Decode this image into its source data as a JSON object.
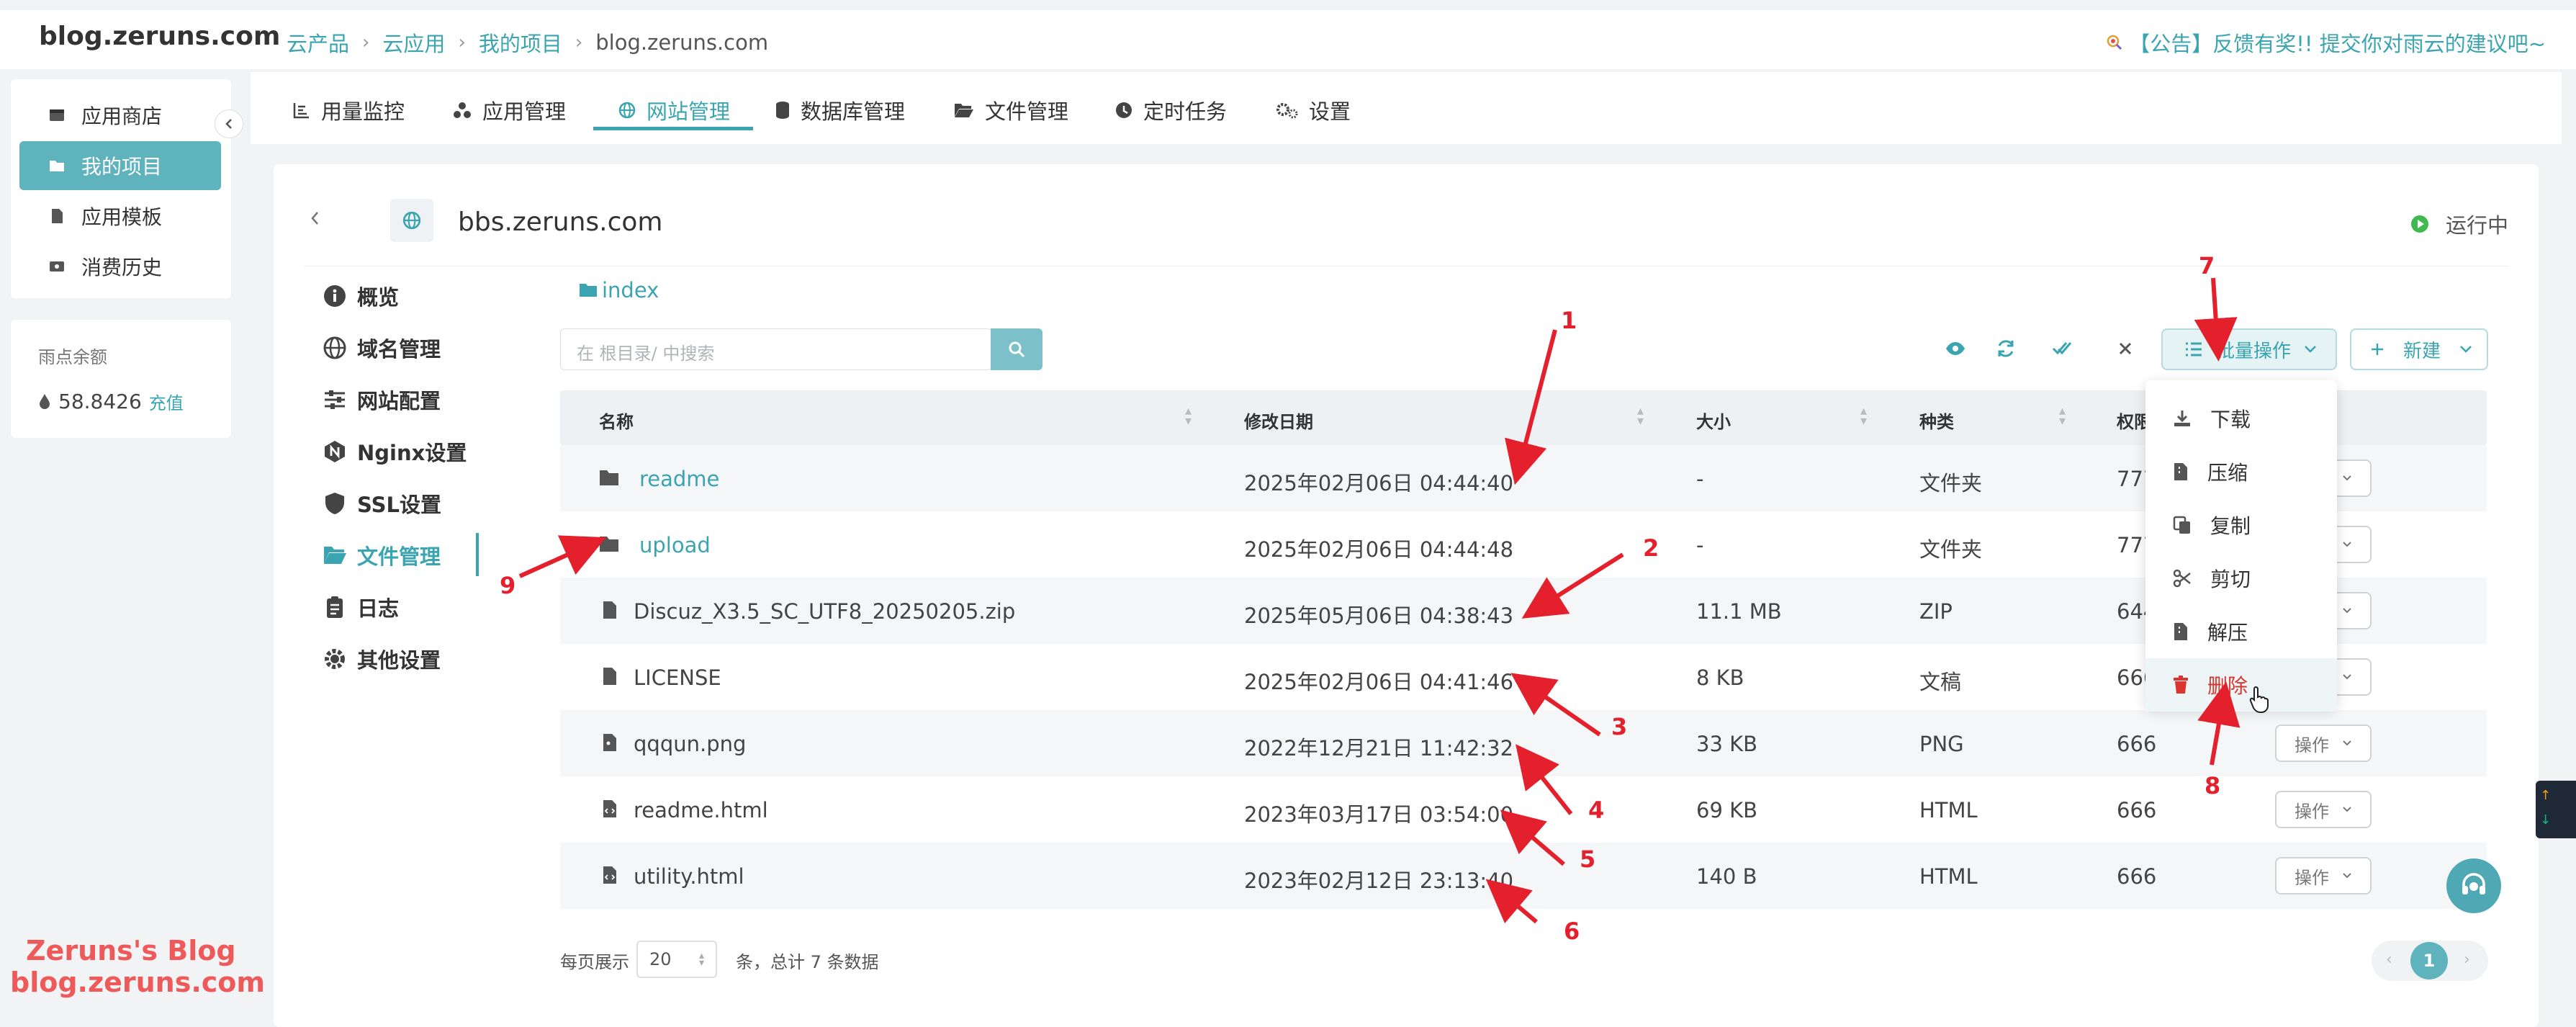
{
  "header": {
    "site": "blog.zeruns.com",
    "breadcrumb": [
      "云产品",
      "云应用",
      "我的项目",
      "blog.zeruns.com"
    ],
    "notice": "【公告】反馈有奖!! 提交你对雨云的建议吧~"
  },
  "sidebar": {
    "items": [
      {
        "label": "应用商店",
        "icon": "store-icon"
      },
      {
        "label": "我的项目",
        "icon": "folder-icon",
        "active": true
      },
      {
        "label": "应用模板",
        "icon": "template-icon"
      },
      {
        "label": "消费历史",
        "icon": "history-icon"
      }
    ]
  },
  "balance": {
    "label": "雨点余额",
    "amount": "58.8426",
    "recharge": "充值"
  },
  "tabs": [
    {
      "label": "用量监控",
      "icon": "chart-icon"
    },
    {
      "label": "应用管理",
      "icon": "apps-icon"
    },
    {
      "label": "网站管理",
      "icon": "globe-icon",
      "active": true
    },
    {
      "label": "数据库管理",
      "icon": "database-icon"
    },
    {
      "label": "文件管理",
      "icon": "folder-open-icon"
    },
    {
      "label": "定时任务",
      "icon": "clock-icon"
    },
    {
      "label": "设置",
      "icon": "gears-icon"
    }
  ],
  "site": {
    "title": "bbs.zeruns.com",
    "status": "运行中"
  },
  "site_menu": {
    "items": [
      {
        "label": "概览",
        "icon": "info-icon"
      },
      {
        "label": "域名管理",
        "icon": "globe-icon"
      },
      {
        "label": "网站配置",
        "icon": "sliders-icon"
      },
      {
        "label": "Nginx设置",
        "icon": "nginx-icon"
      },
      {
        "label": "SSL设置",
        "icon": "shield-icon"
      },
      {
        "label": "文件管理",
        "icon": "folder-open-icon",
        "active": true
      },
      {
        "label": "日志",
        "icon": "clipboard-icon"
      },
      {
        "label": "其他设置",
        "icon": "gear-icon"
      }
    ]
  },
  "files": {
    "path": "index",
    "search_placeholder": "在 根目录/ 中搜索",
    "batch_label": "批量操作",
    "new_label": "新建",
    "columns": [
      "名称",
      "修改日期",
      "大小",
      "种类",
      "权限"
    ],
    "rows": [
      {
        "name": "readme",
        "date": "2025年02月06日 04:44:40",
        "size": "-",
        "type": "文件夹",
        "perm": "777",
        "folder": true
      },
      {
        "name": "upload",
        "date": "2025年02月06日 04:44:48",
        "size": "-",
        "type": "文件夹",
        "perm": "777",
        "folder": true
      },
      {
        "name": "Discuz_X3.5_SC_UTF8_20250205.zip",
        "date": "2025年05月06日 04:38:43",
        "size": "11.1 MB",
        "type": "ZIP",
        "perm": "644"
      },
      {
        "name": "LICENSE",
        "date": "2025年02月06日 04:41:46",
        "size": "8 KB",
        "type": "文稿",
        "perm": "666"
      },
      {
        "name": "qqqun.png",
        "date": "2022年12月21日 11:42:32",
        "size": "33 KB",
        "type": "PNG",
        "perm": "666"
      },
      {
        "name": "readme.html",
        "date": "2023年03月17日 03:54:00",
        "size": "69 KB",
        "type": "HTML",
        "perm": "666"
      },
      {
        "name": "utility.html",
        "date": "2023年02月12日 23:13:40",
        "size": "140 B",
        "type": "HTML",
        "perm": "666"
      }
    ],
    "op_label": "操作"
  },
  "batch_menu": [
    {
      "label": "下载",
      "icon": "download-icon"
    },
    {
      "label": "压缩",
      "icon": "compress-icon"
    },
    {
      "label": "复制",
      "icon": "copy-icon"
    },
    {
      "label": "剪切",
      "icon": "scissors-icon"
    },
    {
      "label": "解压",
      "icon": "extract-icon"
    },
    {
      "label": "删除",
      "icon": "trash-icon",
      "danger": true
    }
  ],
  "pagination": {
    "per_page_label": "每页展示",
    "per_page": "20",
    "total_text": "条，总计 7 条数据",
    "page": "1"
  },
  "annotations": [
    "1",
    "2",
    "3",
    "4",
    "5",
    "6",
    "7",
    "8",
    "9"
  ],
  "watermark": {
    "line1": "Zeruns's Blog",
    "line2": "blog.zeruns.com"
  },
  "colors": {
    "accent": "#3aa5b0",
    "active_nav": "#5fb3bd",
    "annotation": "#e3202b",
    "danger": "#d9362f"
  }
}
